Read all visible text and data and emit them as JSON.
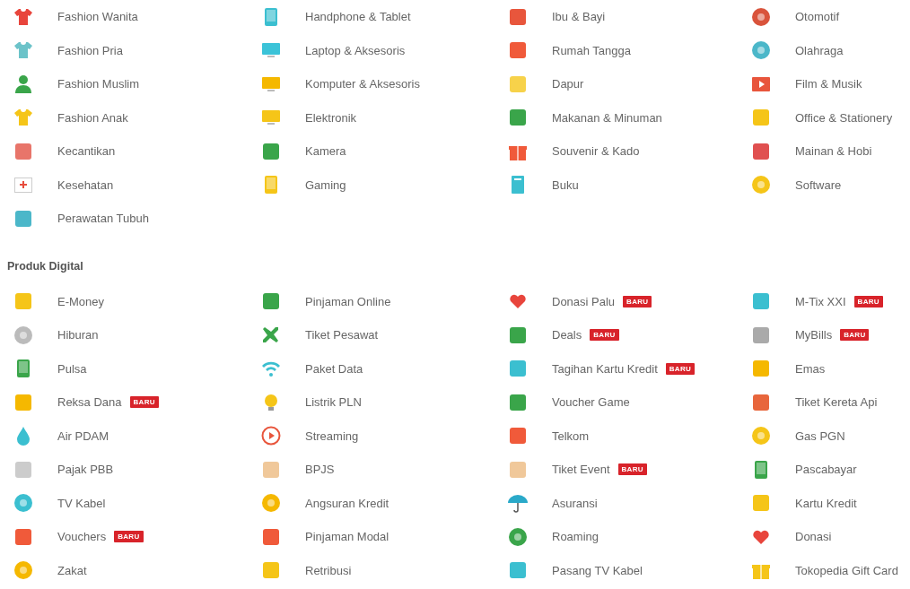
{
  "sections": [
    {
      "items": [
        {
          "label": "Fashion Wanita"
        },
        {
          "label": "Handphone & Tablet"
        },
        {
          "label": "Ibu & Bayi"
        },
        {
          "label": "Otomotif"
        },
        {
          "label": "Fashion Pria"
        },
        {
          "label": "Laptop & Aksesoris"
        },
        {
          "label": "Rumah Tangga"
        },
        {
          "label": "Olahraga"
        },
        {
          "label": "Fashion Muslim"
        },
        {
          "label": "Komputer & Aksesoris"
        },
        {
          "label": "Dapur"
        },
        {
          "label": "Film & Musik"
        },
        {
          "label": "Fashion Anak"
        },
        {
          "label": "Elektronik"
        },
        {
          "label": "Makanan & Minuman"
        },
        {
          "label": "Office & Stationery"
        },
        {
          "label": "Kecantikan"
        },
        {
          "label": "Kamera"
        },
        {
          "label": "Souvenir & Kado"
        },
        {
          "label": "Mainan & Hobi"
        },
        {
          "label": "Kesehatan"
        },
        {
          "label": "Gaming"
        },
        {
          "label": "Buku"
        },
        {
          "label": "Software"
        },
        {
          "label": "Perawatan Tubuh"
        }
      ]
    },
    {
      "title": "Produk Digital",
      "items": [
        {
          "label": "E-Money"
        },
        {
          "label": "Pinjaman Online"
        },
        {
          "label": "Donasi Palu",
          "badge": "BARU"
        },
        {
          "label": "M-Tix XXI",
          "badge": "BARU"
        },
        {
          "label": "Hiburan"
        },
        {
          "label": "Tiket Pesawat"
        },
        {
          "label": "Deals",
          "badge": "BARU"
        },
        {
          "label": "MyBills",
          "badge": "BARU"
        },
        {
          "label": "Pulsa"
        },
        {
          "label": "Paket Data"
        },
        {
          "label": "Tagihan Kartu Kredit",
          "badge": "BARU"
        },
        {
          "label": "Emas"
        },
        {
          "label": "Reksa Dana",
          "badge": "BARU"
        },
        {
          "label": "Listrik PLN"
        },
        {
          "label": "Voucher Game"
        },
        {
          "label": "Tiket Kereta Api"
        },
        {
          "label": "Air PDAM"
        },
        {
          "label": "Streaming"
        },
        {
          "label": "Telkom"
        },
        {
          "label": "Gas PGN"
        },
        {
          "label": "Pajak PBB"
        },
        {
          "label": "BPJS"
        },
        {
          "label": "Tiket Event",
          "badge": "BARU"
        },
        {
          "label": "Pascabayar"
        },
        {
          "label": "TV Kabel"
        },
        {
          "label": "Angsuran Kredit"
        },
        {
          "label": "Asuransi"
        },
        {
          "label": "Kartu Kredit"
        },
        {
          "label": "Vouchers",
          "badge": "BARU"
        },
        {
          "label": "Pinjaman Modal"
        },
        {
          "label": "Roaming"
        },
        {
          "label": "Donasi"
        },
        {
          "label": "Zakat"
        },
        {
          "label": "Retribusi"
        },
        {
          "label": "Pasang TV Kabel"
        },
        {
          "label": "Tokopedia Gift Card"
        }
      ]
    }
  ]
}
